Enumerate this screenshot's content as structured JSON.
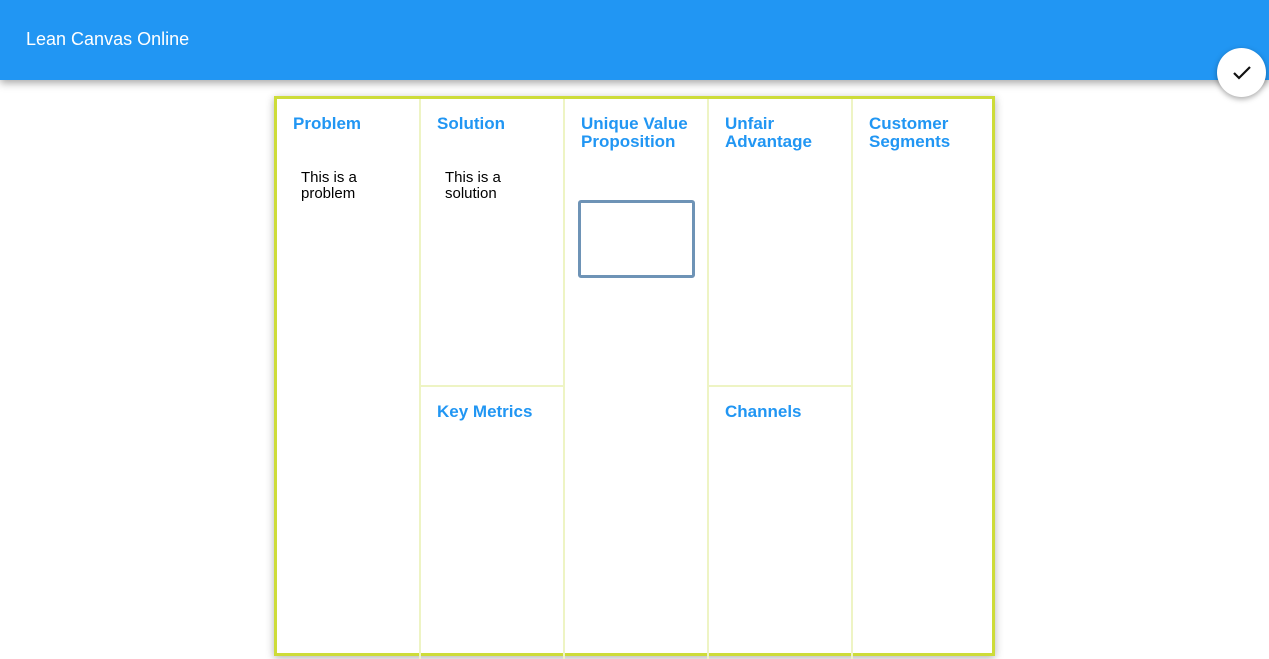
{
  "app_bar": {
    "title": "Lean Canvas Online"
  },
  "fab": {
    "icon": "check-icon"
  },
  "canvas": {
    "problem": {
      "title": "Problem",
      "note": "This is a problem"
    },
    "solution": {
      "title": "Solution",
      "note": "This is a solution"
    },
    "key_metrics": {
      "title": "Key Metrics"
    },
    "uvp": {
      "title": "Unique Value Proposition",
      "input_value": ""
    },
    "unfair_advantage": {
      "title": "Unfair Advantage"
    },
    "channels": {
      "title": "Channels"
    },
    "customer_segments": {
      "title": "Customer Segments"
    }
  },
  "colors": {
    "primary": "#2196f3",
    "canvas_border": "#cddc39",
    "divider": "#eef4c4"
  }
}
